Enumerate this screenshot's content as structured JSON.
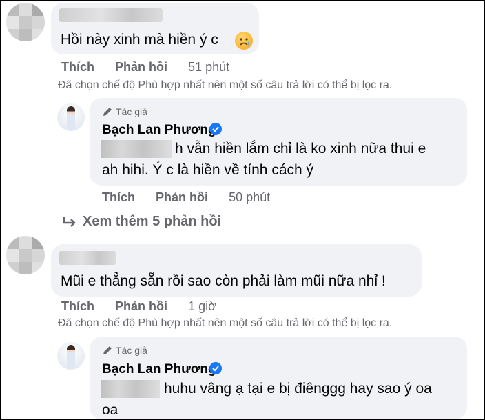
{
  "comments": [
    {
      "text": "Hồi này xinh mà hiền ý c",
      "emoji": "sad-face-emoji",
      "actions": {
        "like": "Thích",
        "reply": "Phản hồi",
        "time": "51 phút"
      },
      "notice": "Đã chọn chế độ Phù hợp nhất nên một số câu trả lời có thể bị lọc ra.",
      "reply": {
        "badge": "Tác giả",
        "author": "Bạch Lan Phương",
        "line1": "h vẫn hiền lắm chỉ là ko xinh nữa thui e",
        "line2": "ah hihi. Ý c là hiền về tính cách ý",
        "actions": {
          "like": "Thích",
          "reply": "Phản hồi",
          "time": "50 phút"
        }
      }
    },
    {
      "text": "Mũi e thẳng sẵn rồi sao còn phải làm mũi nữa nhỉ !",
      "actions": {
        "like": "Thích",
        "reply": "Phản hồi",
        "time": "1 giờ"
      },
      "notice": "Đã chọn chế độ Phù hợp nhất nên một số câu trả lời có thể bị lọc ra.",
      "reply": {
        "badge": "Tác giả",
        "author": "Bạch Lan Phương",
        "line1": "huhu vâng ạ tại e bị điênggg hay sao ý oa",
        "line2": "oa"
      }
    }
  ],
  "see_more": "Xem thêm 5 phản hồi",
  "colors": {
    "bubble": "#f0f2f5",
    "secondary_text": "#65676b",
    "verified": "#1877f2"
  }
}
